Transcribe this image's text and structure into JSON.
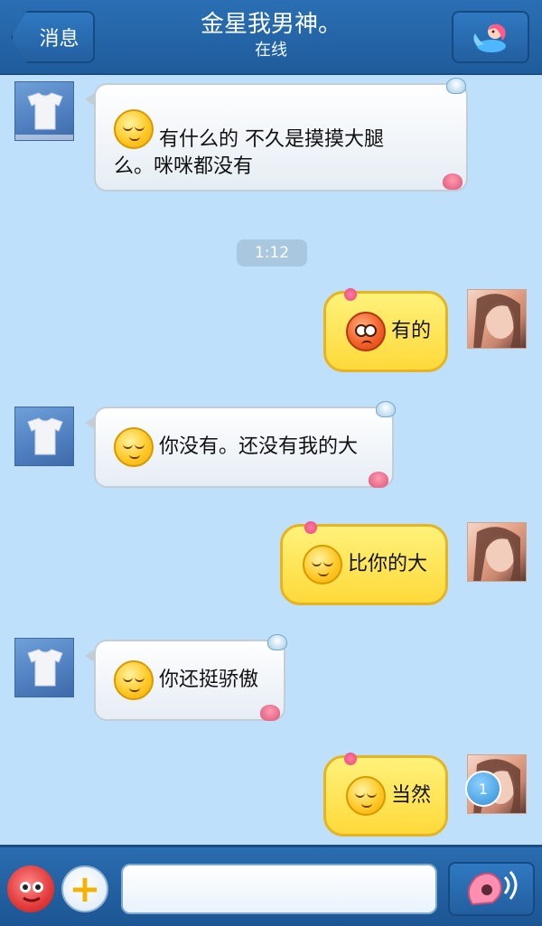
{
  "header": {
    "back_label": "消息",
    "title": "金星我男神。",
    "status": "在线",
    "theme_icon": "mermaid-icon"
  },
  "messages": [
    {
      "side": "left",
      "text": "有什么的 不久是摸摸大腿么。咪咪都没有",
      "emoji": "sleepy-smile"
    },
    {
      "side": "time",
      "text": "1:12"
    },
    {
      "side": "right",
      "text": "有的",
      "emoji": "worried-face"
    },
    {
      "side": "left",
      "text": "你没有。还没有我的大",
      "emoji": "sleepy-smile"
    },
    {
      "side": "right",
      "text": "比你的大",
      "emoji": "sleepy-smile"
    },
    {
      "side": "left",
      "text": "你还挺骄傲",
      "emoji": "sleepy-smile"
    },
    {
      "side": "right",
      "text": "当然",
      "emoji": "sleepy-smile"
    }
  ],
  "msg_lines": [
    "有什么的  不久是摸摸大腿",
    "么。咪咪都没有"
  ],
  "unread_count": "1",
  "input_bar": {
    "placeholder": "",
    "fish_icon": "fish-icon",
    "plus_icon": "plus-icon",
    "voice_icon": "conch-voice-icon"
  },
  "colors": {
    "header": "#2466a8",
    "background": "#bfe0fb",
    "bubble_right": "#ffe34a",
    "bubble_left": "#f4f7fa"
  }
}
